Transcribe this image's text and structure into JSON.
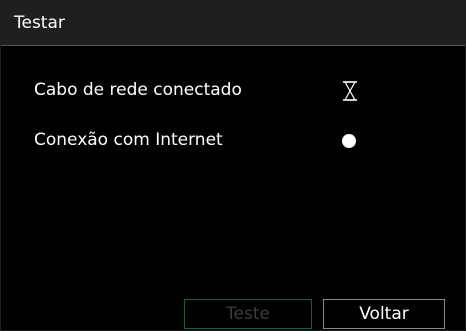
{
  "dialog": {
    "title": "Testar"
  },
  "checks": [
    {
      "label": "Cabo de rede conectado",
      "status_icon": "hourglass-icon"
    },
    {
      "label": "Conexão com Internet",
      "status_icon": "status-dot-icon"
    }
  ],
  "buttons": {
    "test_label": "Teste",
    "back_label": "Voltar"
  },
  "colors": {
    "background": "#000000",
    "titlebar": "#1f1f1f",
    "test_button_border": "#1f5a4a",
    "test_button_text_disabled": "#3c3c3c",
    "back_button_border": "#8a8a8a"
  }
}
